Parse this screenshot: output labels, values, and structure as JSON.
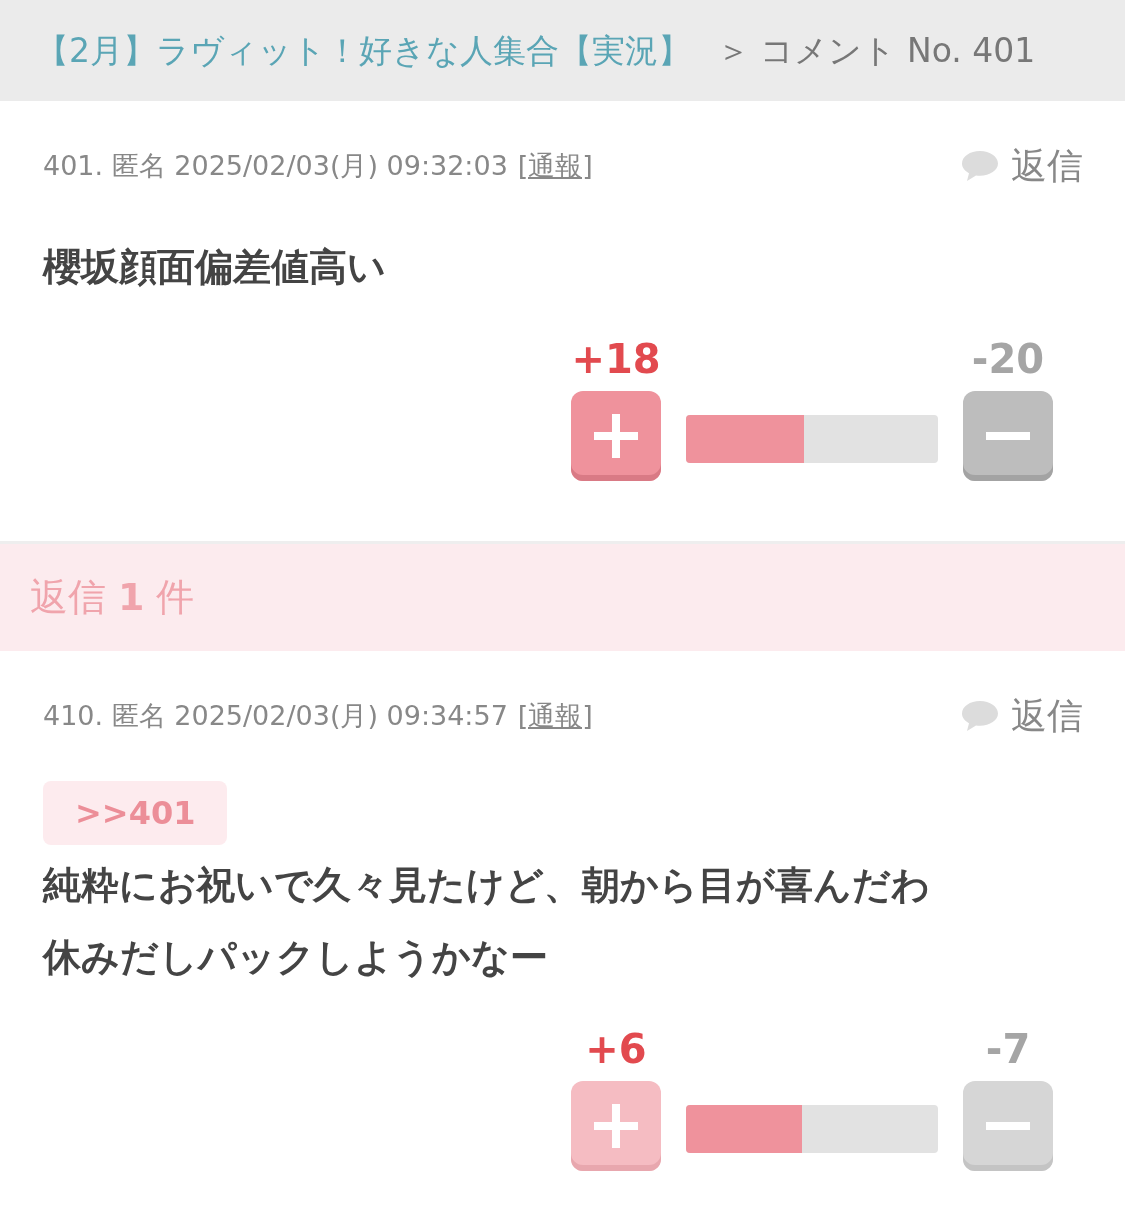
{
  "breadcrumb": {
    "thread": "【2月】ラヴィット！好きな人集合【実況】",
    "current": "＞ コメント No. 401"
  },
  "comments": [
    {
      "meta": "401. 匿名 2025/02/03(月) 09:32:03",
      "report": "[通報]",
      "reply": "返信",
      "body": [
        "櫻坂顔面偏差値高い"
      ],
      "votes": {
        "plus": "+18",
        "minus": "-20",
        "level": 0.47,
        "disabled": false
      }
    },
    {
      "meta": "410. 匿名 2025/02/03(月) 09:34:57",
      "report": "[通報]",
      "reply": "返信",
      "anchor": ">>401",
      "body": [
        "純粋にお祝いで久々見たけど、朝から目が喜んだわ",
        "休みだしパックしようかなー"
      ],
      "votes": {
        "plus": "+6",
        "minus": "-7",
        "level": 0.46,
        "disabled": true
      }
    }
  ],
  "replies_band": {
    "label": "返信",
    "count": "1",
    "unit": "件"
  }
}
